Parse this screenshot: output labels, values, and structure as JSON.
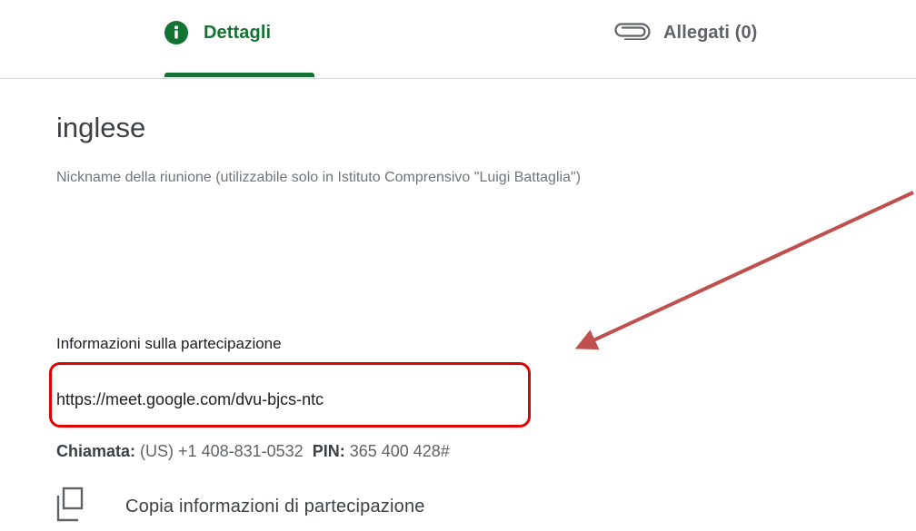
{
  "tabs": {
    "details_label": "Dettagli",
    "attachments_label": "Allegati (0)"
  },
  "event": {
    "title": "inglese",
    "nickname_note": "Nickname della riunione (utilizzabile solo in Istituto Comprensivo \"Luigi Battaglia\")"
  },
  "join_info": {
    "heading": "Informazioni sulla partecipazione",
    "meet_link": "https://meet.google.com/dvu-bjcs-ntc",
    "call_label": "Chiamata:",
    "call_number": "(US) +1 408-831-0532",
    "pin_label": "PIN:",
    "pin_value": "365 400 428#",
    "copy_label": "Copia informazioni di partecipazione"
  },
  "colors": {
    "accent_green": "#137333",
    "highlight_red": "#e00000",
    "arrow_red": "#c0504d"
  },
  "icons": [
    "info-icon",
    "paperclip-icon",
    "copy-icon"
  ]
}
